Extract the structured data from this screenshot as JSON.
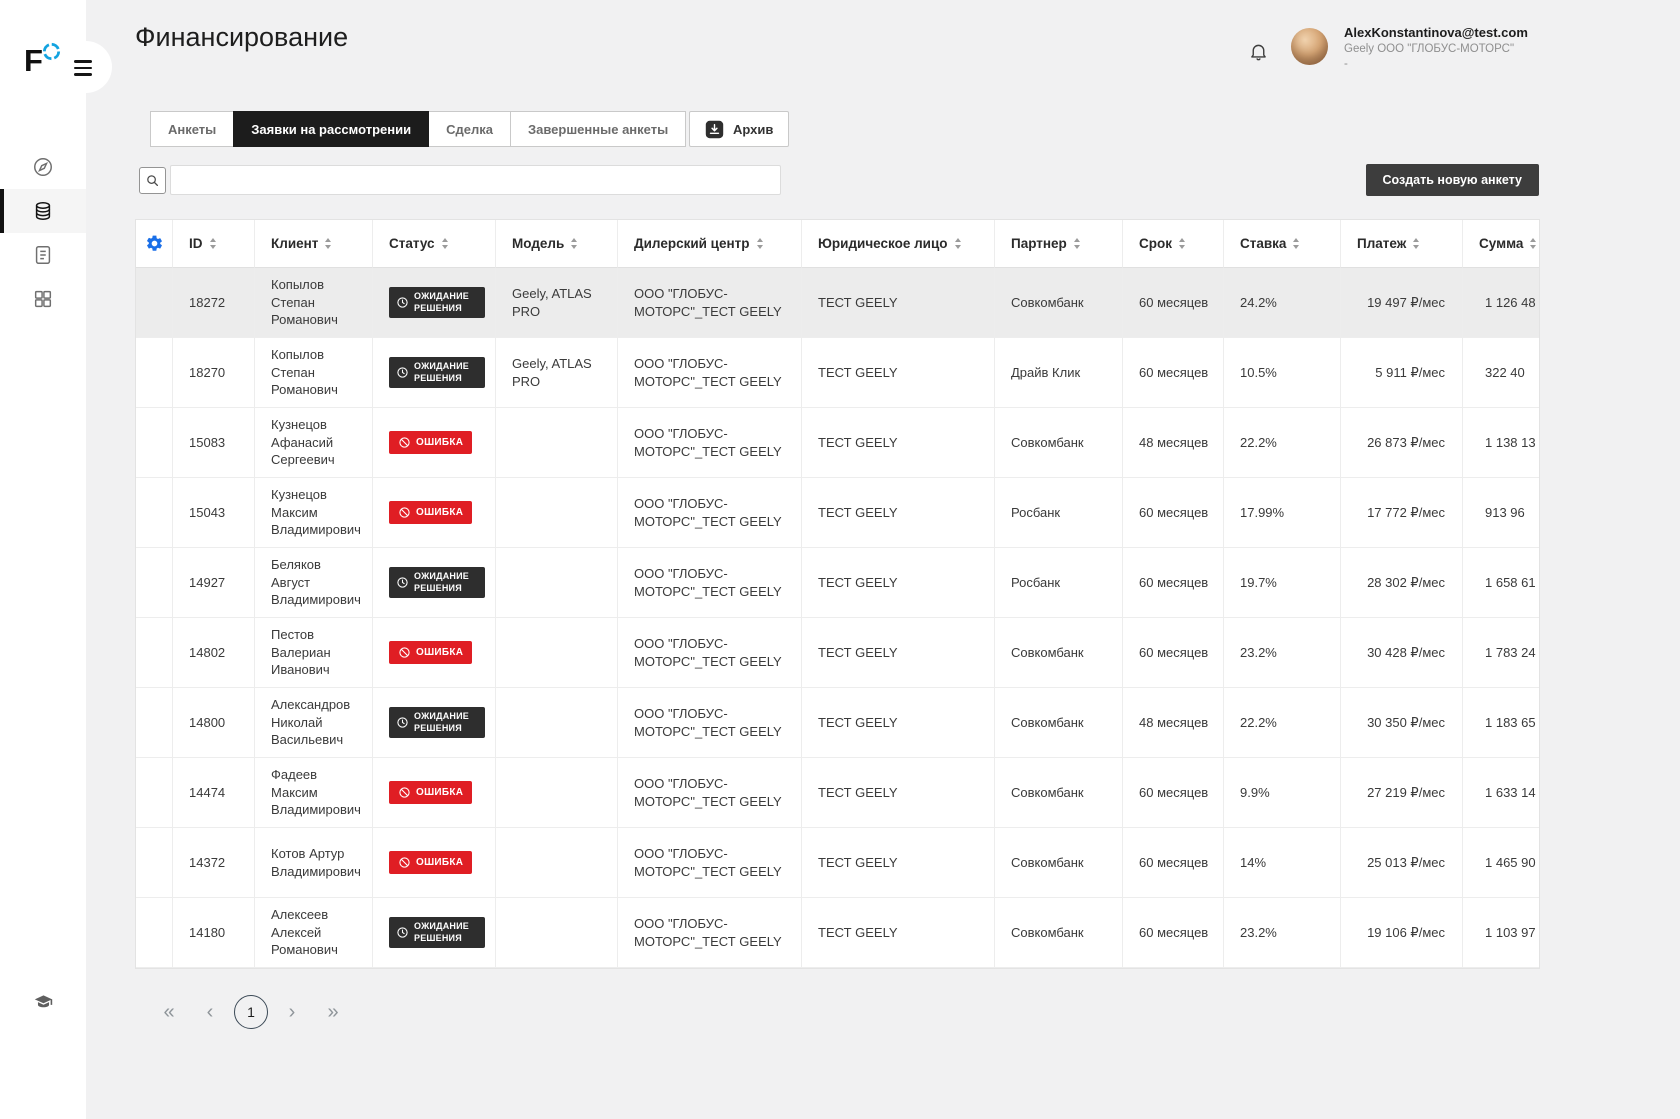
{
  "app": {
    "logo_letter": "F",
    "title": "Финансирование"
  },
  "user": {
    "email": "AlexKonstantinova@test.com",
    "organization": "Geely ООО \"ГЛОБУС-МОТОРС\"",
    "extra": "-"
  },
  "tabs": {
    "items": [
      {
        "label": "Анкеты",
        "active": false
      },
      {
        "label": "Заявки на рассмотрении",
        "active": true
      },
      {
        "label": "Сделка",
        "active": false
      },
      {
        "label": "Завершенные анкеты",
        "active": false
      }
    ]
  },
  "toolbar": {
    "archive_label": "Архив",
    "create_label": "Создать новую анкету",
    "search_value": "",
    "search_placeholder": ""
  },
  "statuses": {
    "waiting": {
      "label": "ОЖИДАНИЕ РЕШЕНИЯ",
      "color": "#2e2e2e"
    },
    "error": {
      "label": "ОШИБКА",
      "color": "#e01e24"
    }
  },
  "table": {
    "columns": [
      {
        "key": "id",
        "label": "ID"
      },
      {
        "key": "client",
        "label": "Клиент"
      },
      {
        "key": "status",
        "label": "Статус"
      },
      {
        "key": "model",
        "label": "Модель"
      },
      {
        "key": "dealer",
        "label": "Дилерский центр"
      },
      {
        "key": "legal",
        "label": "Юридическое лицо"
      },
      {
        "key": "partner",
        "label": "Партнер"
      },
      {
        "key": "term",
        "label": "Срок"
      },
      {
        "key": "rate",
        "label": "Ставка"
      },
      {
        "key": "payment",
        "label": "Платеж"
      },
      {
        "key": "sum",
        "label": "Сумма"
      }
    ],
    "rows": [
      {
        "id": "18272",
        "client": "Копылов Степан Романович",
        "status": "waiting",
        "model": "Geely, ATLAS PRO",
        "dealer": "ООО \"ГЛОБУС-МОТОРС\"_ТЕСТ GEELY",
        "legal": "ТЕСТ GEELY",
        "partner": "Совкомбанк",
        "term": "60 месяцев",
        "rate": "24.2%",
        "payment": "19 497 ₽/мес",
        "sum": "1 126 48",
        "highlighted": true
      },
      {
        "id": "18270",
        "client": "Копылов Степан Романович",
        "status": "waiting",
        "model": "Geely, ATLAS PRO",
        "dealer": "ООО \"ГЛОБУС-МОТОРС\"_ТЕСТ GEELY",
        "legal": "ТЕСТ GEELY",
        "partner": "Драйв Клик",
        "term": "60 месяцев",
        "rate": "10.5%",
        "payment": "5 911 ₽/мес",
        "sum": "322 40",
        "highlighted": false
      },
      {
        "id": "15083",
        "client": "Кузнецов Афанасий Сергеевич",
        "status": "error",
        "model": "",
        "dealer": "ООО \"ГЛОБУС-МОТОРС\"_ТЕСТ GEELY",
        "legal": "ТЕСТ GEELY",
        "partner": "Совкомбанк",
        "term": "48 месяцев",
        "rate": "22.2%",
        "payment": "26 873 ₽/мес",
        "sum": "1 138 13",
        "highlighted": false
      },
      {
        "id": "15043",
        "client": "Кузнецов Максим Владимирович",
        "status": "error",
        "model": "",
        "dealer": "ООО \"ГЛОБУС-МОТОРС\"_ТЕСТ GEELY",
        "legal": "ТЕСТ GEELY",
        "partner": "Росбанк",
        "term": "60 месяцев",
        "rate": "17.99%",
        "payment": "17 772 ₽/мес",
        "sum": "913 96",
        "highlighted": false
      },
      {
        "id": "14927",
        "client": "Беляков Август Владимирович",
        "status": "waiting",
        "model": "",
        "dealer": "ООО \"ГЛОБУС-МОТОРС\"_ТЕСТ GEELY",
        "legal": "ТЕСТ GEELY",
        "partner": "Росбанк",
        "term": "60 месяцев",
        "rate": "19.7%",
        "payment": "28 302 ₽/мес",
        "sum": "1 658 61",
        "highlighted": false
      },
      {
        "id": "14802",
        "client": "Пестов Валериан Иванович",
        "status": "error",
        "model": "",
        "dealer": "ООО \"ГЛОБУС-МОТОРС\"_ТЕСТ GEELY",
        "legal": "ТЕСТ GEELY",
        "partner": "Совкомбанк",
        "term": "60 месяцев",
        "rate": "23.2%",
        "payment": "30 428 ₽/мес",
        "sum": "1 783 24",
        "highlighted": false
      },
      {
        "id": "14800",
        "client": "Александров Николай Васильевич",
        "status": "waiting",
        "model": "",
        "dealer": "ООО \"ГЛОБУС-МОТОРС\"_ТЕСТ GEELY",
        "legal": "ТЕСТ GEELY",
        "partner": "Совкомбанк",
        "term": "48 месяцев",
        "rate": "22.2%",
        "payment": "30 350 ₽/мес",
        "sum": "1 183 65",
        "highlighted": false
      },
      {
        "id": "14474",
        "client": "Фадеев Максим Владимирович",
        "status": "error",
        "model": "",
        "dealer": "ООО \"ГЛОБУС-МОТОРС\"_ТЕСТ GEELY",
        "legal": "ТЕСТ GEELY",
        "partner": "Совкомбанк",
        "term": "60 месяцев",
        "rate": "9.9%",
        "payment": "27 219 ₽/мес",
        "sum": "1 633 14",
        "highlighted": false
      },
      {
        "id": "14372",
        "client": "Котов Артур Владимирович",
        "status": "error",
        "model": "",
        "dealer": "ООО \"ГЛОБУС-МОТОРС\"_ТЕСТ GEELY",
        "legal": "ТЕСТ GEELY",
        "partner": "Совкомбанк",
        "term": "60 месяцев",
        "rate": "14%",
        "payment": "25 013 ₽/мес",
        "sum": "1 465 90",
        "highlighted": false
      },
      {
        "id": "14180",
        "client": "Алексеев Алексей Романович",
        "status": "waiting",
        "model": "",
        "dealer": "ООО \"ГЛОБУС-МОТОРС\"_ТЕСТ GEELY",
        "legal": "ТЕСТ GEELY",
        "partner": "Совкомбанк",
        "term": "60 месяцев",
        "rate": "23.2%",
        "payment": "19 106 ₽/мес",
        "sum": "1 103 97",
        "highlighted": false
      }
    ]
  },
  "pagination": {
    "page": "1"
  },
  "icons": {
    "first": "«",
    "prev": "‹",
    "next": "›",
    "last": "»"
  },
  "colors": {
    "background": "#f1f1f2",
    "accent_gear": "#1a6fe8",
    "tab_active": "#1c1c1c",
    "badge_waiting": "#2e2e2e",
    "badge_error": "#e01e24",
    "create_button": "#3d3d3d"
  }
}
